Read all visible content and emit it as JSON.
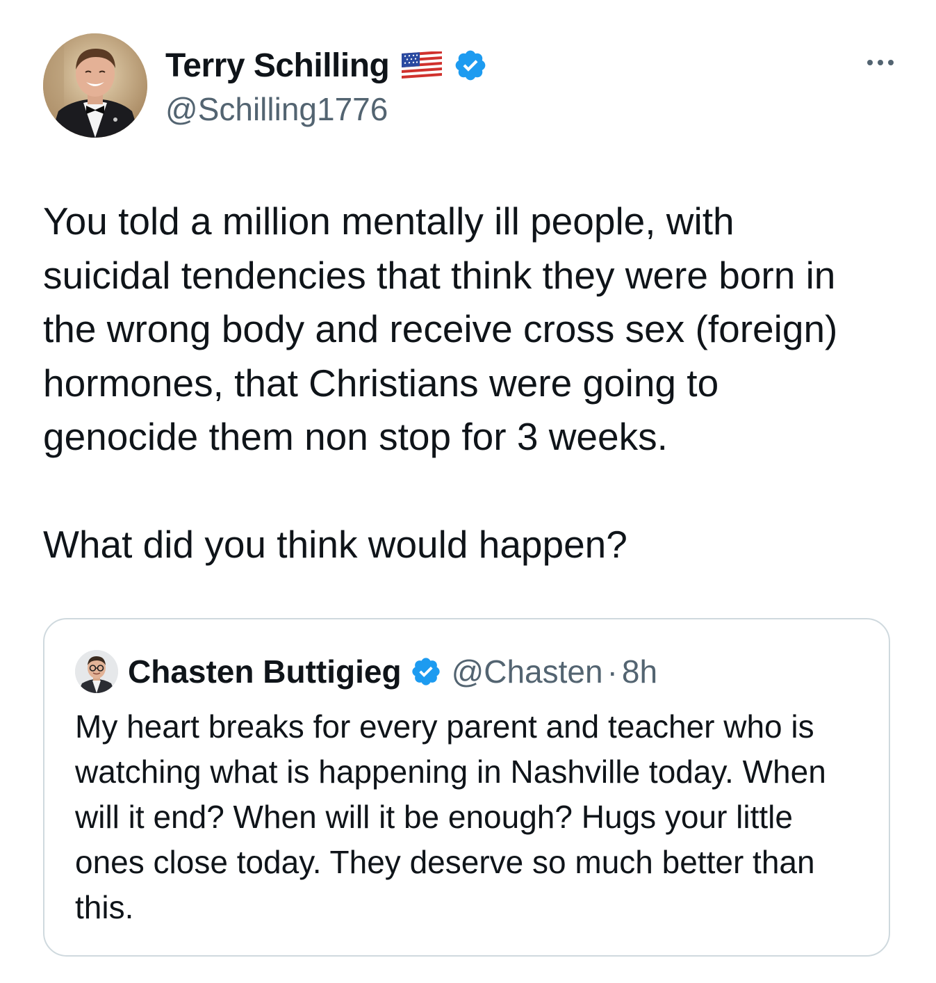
{
  "tweet": {
    "author": {
      "display_name": "Terry Schilling",
      "handle": "@Schilling1776",
      "flag_icon": "us-flag-icon",
      "verified_icon": "verified-badge-icon"
    },
    "more_icon": "more-options-icon",
    "text": "You told a million mentally ill people, with\nsuicidal tendencies that think they were born in\nthe wrong body and receive cross sex (foreign)\nhormones, that Christians were going to\ngenocide them non stop for 3 weeks.\n\nWhat did you think would happen?"
  },
  "quote": {
    "author": {
      "display_name": "Chasten Buttigieg",
      "handle": "@Chasten",
      "separator": "·",
      "time": "8h",
      "verified_icon": "verified-badge-icon"
    },
    "text": "My heart breaks for every parent and teacher who is watching what is happening in Nashville today. When will it end? When will it be enough? Hugs your little ones close today. They deserve so much better than this."
  },
  "colors": {
    "text_primary": "#0f1419",
    "text_secondary": "#536471",
    "verified_blue": "#1d9bf0",
    "border": "#cfd9de"
  }
}
